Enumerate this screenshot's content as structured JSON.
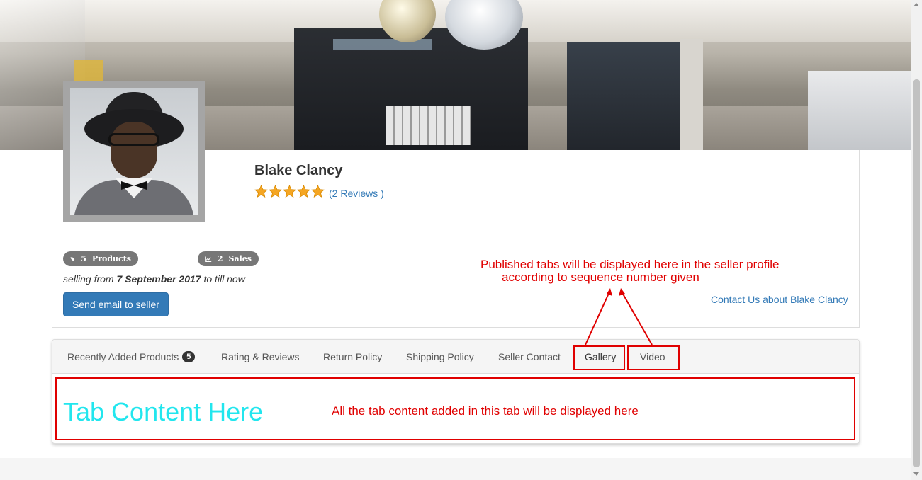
{
  "seller": {
    "name": "Blake Clancy",
    "rating": 5,
    "rating_max": 5,
    "reviews_label": "(2 Reviews )",
    "products_count": "5",
    "products_label": "Products",
    "sales_count": "2",
    "sales_label": "Sales",
    "selling_prefix": "selling from",
    "selling_date": "7 September 2017",
    "selling_suffix": "to till now",
    "send_email_label": "Send email to seller",
    "contact_label": "Contact Us about Blake Clancy"
  },
  "annotations": {
    "tabs_note_line1": "Published tabs will be displayed here in the seller profile",
    "tabs_note_line2": "according to sequence number given",
    "content_note": "All the tab content added in this tab will be displayed here"
  },
  "tabs": {
    "recent_label": "Recently Added Products",
    "recent_count": "5",
    "rating_label": "Rating & Reviews",
    "return_label": "Return Policy",
    "shipping_label": "Shipping Policy",
    "contact_label": "Seller Contact",
    "gallery_label": "Gallery",
    "video_label": "Video"
  },
  "content": {
    "title": "Tab Content Here"
  },
  "colors": {
    "link": "#337ab7",
    "primary_button": "#337ab7",
    "annotation": "#e00000",
    "star": "#f5a623",
    "content_title": "#22e6ee"
  },
  "icons": {
    "products_badge": "tags-icon",
    "sales_badge": "line-chart-icon"
  }
}
